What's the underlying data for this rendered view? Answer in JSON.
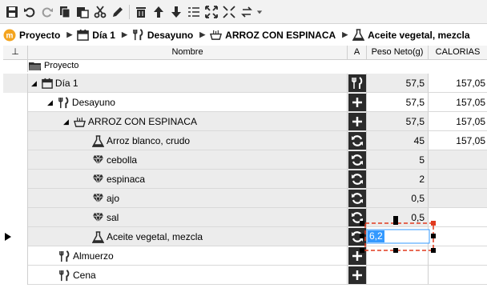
{
  "toolbar": {
    "icons": [
      "save-icon",
      "undo-icon",
      "redo-icon",
      "copy-icon",
      "paste-icon",
      "cut-icon",
      "edit-icon",
      "delete-icon",
      "move-up-icon",
      "move-down-icon",
      "list-icon",
      "expand-icon",
      "collapse-icon",
      "swap-icon"
    ]
  },
  "breadcrumb": [
    {
      "label": "Proyecto",
      "icon": "project-logo-icon"
    },
    {
      "label": "Día 1",
      "icon": "calendar-icon"
    },
    {
      "label": "Desayuno",
      "icon": "fork-knife-icon"
    },
    {
      "label": "ARROZ CON ESPINACA",
      "icon": "bowl-icon"
    },
    {
      "label": "Aceite vegetal, mezcla",
      "icon": "flask-icon"
    }
  ],
  "grid": {
    "headers": {
      "pin": "⊥",
      "name": "Nombre",
      "a": "A",
      "peso": "Peso Neto(g)",
      "cal": "CALORIAS"
    },
    "rows": [
      {
        "name": "Proyecto",
        "icon": "folder-icon",
        "peso": "",
        "cal": "",
        "a": "none"
      },
      {
        "name": "Día 1",
        "icon": "calendar-icon",
        "peso": "57,5",
        "cal": "157,05",
        "a": "fork-knife"
      },
      {
        "name": "Desayuno",
        "icon": "fork-knife-icon",
        "peso": "57,5",
        "cal": "157,05",
        "a": "plus"
      },
      {
        "name": "ARROZ CON ESPINACA",
        "icon": "bowl-icon",
        "peso": "57,5",
        "cal": "157,05",
        "a": "plus"
      },
      {
        "name": "Arroz blanco, crudo",
        "icon": "flask-icon",
        "peso": "45",
        "cal": "157,05",
        "a": "refresh"
      },
      {
        "name": "cebolla",
        "icon": "gem-icon",
        "peso": "5",
        "cal": "",
        "a": "refresh"
      },
      {
        "name": "espinaca",
        "icon": "gem-icon",
        "peso": "2",
        "cal": "",
        "a": "refresh"
      },
      {
        "name": "ajo",
        "icon": "gem-icon",
        "peso": "0,5",
        "cal": "",
        "a": "refresh"
      },
      {
        "name": "sal",
        "icon": "gem-icon",
        "peso": "0,5",
        "cal": "",
        "a": "refresh"
      },
      {
        "name": "Aceite vegetal, mezcla",
        "icon": "flask-icon",
        "peso": "",
        "cal": "",
        "a": "refresh"
      },
      {
        "name": "Almuerzo",
        "icon": "fork-knife-icon",
        "peso": "",
        "cal": "",
        "a": "plus"
      },
      {
        "name": "Cena",
        "icon": "fork-knife-icon",
        "peso": "",
        "cal": "",
        "a": "plus"
      }
    ],
    "edit_value": "6,2"
  },
  "colors": {
    "accent": "#e03a1e",
    "selection": "#3399ff",
    "group_row": "#ececec"
  }
}
